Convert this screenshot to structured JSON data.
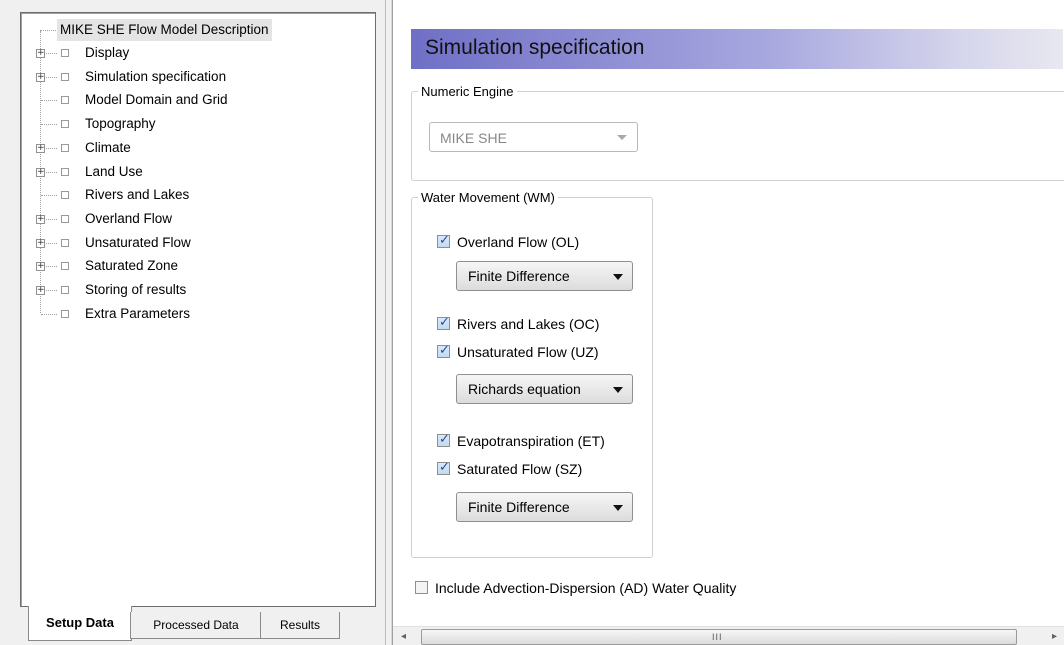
{
  "tree": {
    "root": "MIKE SHE Flow Model Description",
    "items": [
      {
        "label": "Display",
        "expandable": true
      },
      {
        "label": "Simulation specification",
        "expandable": true
      },
      {
        "label": "Model Domain and Grid",
        "expandable": false
      },
      {
        "label": "Topography",
        "expandable": false
      },
      {
        "label": "Climate",
        "expandable": true
      },
      {
        "label": "Land Use",
        "expandable": true
      },
      {
        "label": "Rivers and Lakes",
        "expandable": false
      },
      {
        "label": "Overland Flow",
        "expandable": true
      },
      {
        "label": "Unsaturated Flow",
        "expandable": true
      },
      {
        "label": "Saturated Zone",
        "expandable": true
      },
      {
        "label": "Storing of results",
        "expandable": true
      },
      {
        "label": "Extra Parameters",
        "expandable": false
      }
    ]
  },
  "tabs": [
    {
      "label": "Setup Data",
      "active": true
    },
    {
      "label": "Processed Data",
      "active": false
    },
    {
      "label": "Results",
      "active": false
    }
  ],
  "section": {
    "title": "Simulation specification"
  },
  "numeric_engine": {
    "legend": "Numeric Engine",
    "value": "MIKE SHE"
  },
  "water_movement": {
    "legend": "Water Movement (WM)",
    "overland_flow": {
      "label": "Overland Flow (OL)",
      "checked": true,
      "method": "Finite Difference"
    },
    "rivers_lakes": {
      "label": "Rivers and Lakes (OC)",
      "checked": true
    },
    "unsaturated_flow": {
      "label": "Unsaturated Flow (UZ)",
      "checked": true,
      "method": "Richards equation"
    },
    "evapotranspiration": {
      "label": "Evapotranspiration (ET)",
      "checked": true
    },
    "saturated_flow": {
      "label": "Saturated Flow (SZ)",
      "checked": true,
      "method": "Finite Difference"
    }
  },
  "water_quality": {
    "label": "Include Advection-Dispersion (AD) Water Quality",
    "checked": false
  },
  "scrollbar": {
    "left_arrow": "◂",
    "right_arrow": "▸",
    "grip": "III"
  },
  "glyphs": {
    "checkmark": "✓",
    "plus": "+"
  },
  "colors": {
    "header_gradient_start": "#6f6fc6",
    "header_gradient_end": "#e8e8f0",
    "check": "#2b4a9a"
  }
}
